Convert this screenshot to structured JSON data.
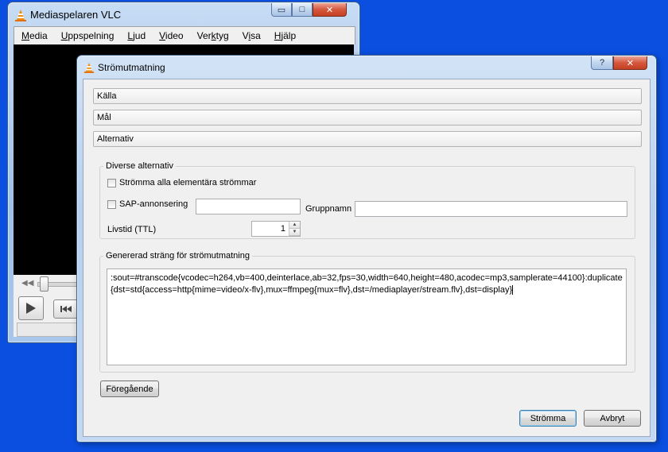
{
  "vlc_window": {
    "title": "Mediaspelaren VLC",
    "menu": [
      "Media",
      "Uppspelning",
      "Ljud",
      "Video",
      "Verktyg",
      "Visa",
      "Hjälp"
    ],
    "mnemonics": [
      "M",
      "U",
      "L",
      "V",
      "k",
      "i",
      "H"
    ],
    "caption_buttons": {
      "minimize": "▭",
      "maximize": "□",
      "close": "✕"
    }
  },
  "dialog": {
    "title": "Strömutmatning",
    "help_symbol": "?",
    "close_symbol": "✕",
    "sections": [
      "Källa",
      "Mål",
      "Alternativ"
    ],
    "misc_group": {
      "legend": "Diverse alternativ",
      "stream_all_label": "Strömma alla elementära strömmar",
      "stream_all_checked": false,
      "sap_label": "SAP-annonsering",
      "sap_checked": false,
      "sap_value": "",
      "group_label": "Gruppnamn",
      "group_value": "",
      "ttl_label": "Livstid (TTL)",
      "ttl_value": "1"
    },
    "generated_group": {
      "legend": "Genererad sträng för strömutmatning",
      "value": ":sout=#transcode{vcodec=h264,vb=400,deinterlace,ab=32,fps=30,width=640,height=480,acodec=mp3,samplerate=44100}:duplicate{dst=std{access=http{mime=video/x-flv},mux=ffmpeg{mux=flv},dst=/mediaplayer/stream.flv},dst=display}"
    },
    "buttons": {
      "previous": "Föregående",
      "stream": "Strömma",
      "cancel": "Avbryt"
    },
    "spin_up": "▲",
    "spin_down": "▼"
  }
}
